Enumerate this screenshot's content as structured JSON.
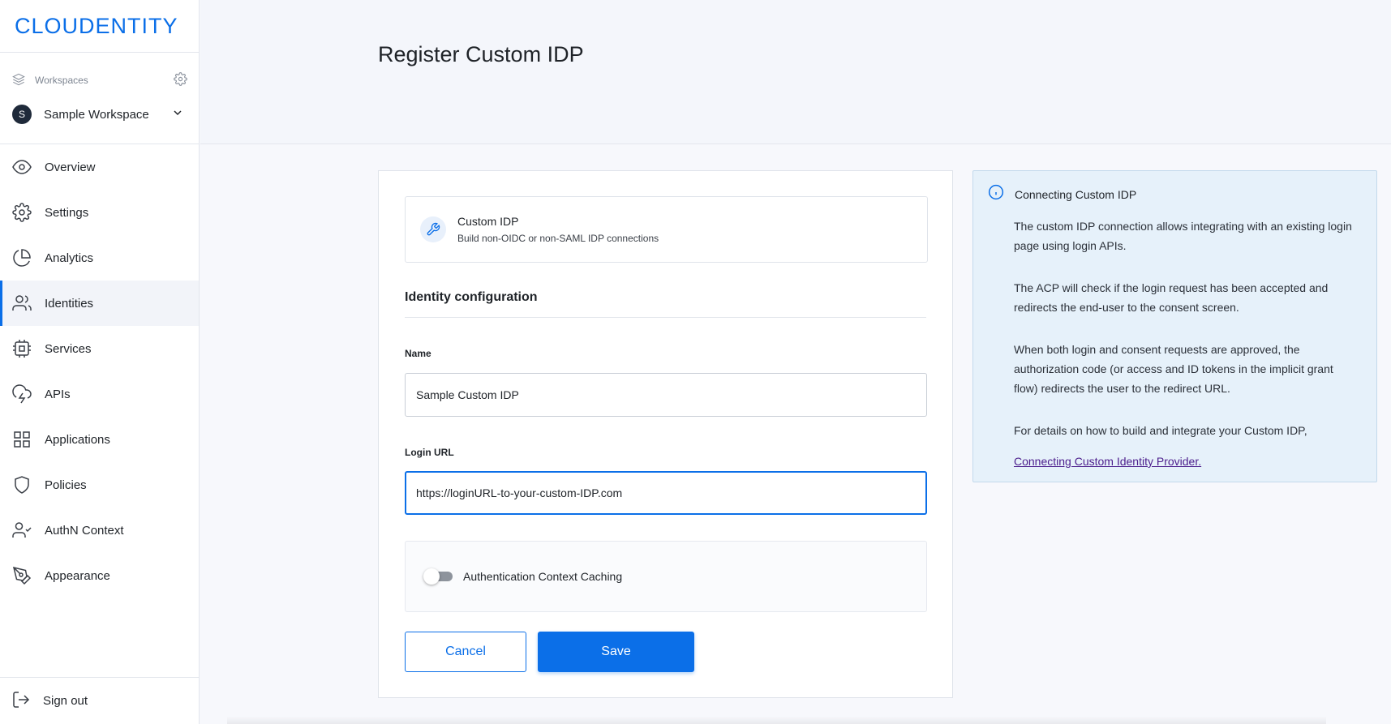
{
  "brand": {
    "logo_text": "CLOUDENTITY",
    "accent_color": "#0b6fe8"
  },
  "workspace": {
    "header_label": "Workspaces",
    "avatar_initial": "S",
    "selected_name": "Sample Workspace"
  },
  "sidebar": {
    "items": [
      {
        "label": "Overview",
        "icon": "eye-icon"
      },
      {
        "label": "Settings",
        "icon": "gear-icon"
      },
      {
        "label": "Analytics",
        "icon": "pie-chart-icon"
      },
      {
        "label": "Identities",
        "icon": "users-icon",
        "active": true
      },
      {
        "label": "Services",
        "icon": "chip-icon"
      },
      {
        "label": "APIs",
        "icon": "cloud-lightning-icon"
      },
      {
        "label": "Applications",
        "icon": "grid-icon"
      },
      {
        "label": "Policies",
        "icon": "shield-icon"
      },
      {
        "label": "AuthN Context",
        "icon": "user-check-icon"
      },
      {
        "label": "Appearance",
        "icon": "pen-tool-icon"
      }
    ],
    "signout_label": "Sign out"
  },
  "page": {
    "title": "Register Custom IDP"
  },
  "form": {
    "idp_card": {
      "title": "Custom IDP",
      "subtitle": "Build non-OIDC or non-SAML IDP connections"
    },
    "section_title": "Identity configuration",
    "name_label": "Name",
    "name_value": "Sample Custom IDP",
    "login_url_label": "Login URL",
    "login_url_value": "https://loginURL-to-your-custom-IDP.com",
    "toggle_label": "Authentication Context Caching",
    "toggle_on": false,
    "cancel_label": "Cancel",
    "save_label": "Save"
  },
  "info": {
    "title": "Connecting Custom IDP",
    "paragraphs": [
      "The custom IDP connection allows integrating with an existing login page using login APIs.",
      "The ACP will check if the login request has been accepted and redirects the end-user to the consent screen.",
      "When both login and consent requests are approved, the authorization code (or access and ID tokens in the implicit grant flow) redirects the user to the redirect URL.",
      "For details on how to build and integrate your Custom IDP,"
    ],
    "link_text": "Connecting Custom Identity Provider."
  }
}
